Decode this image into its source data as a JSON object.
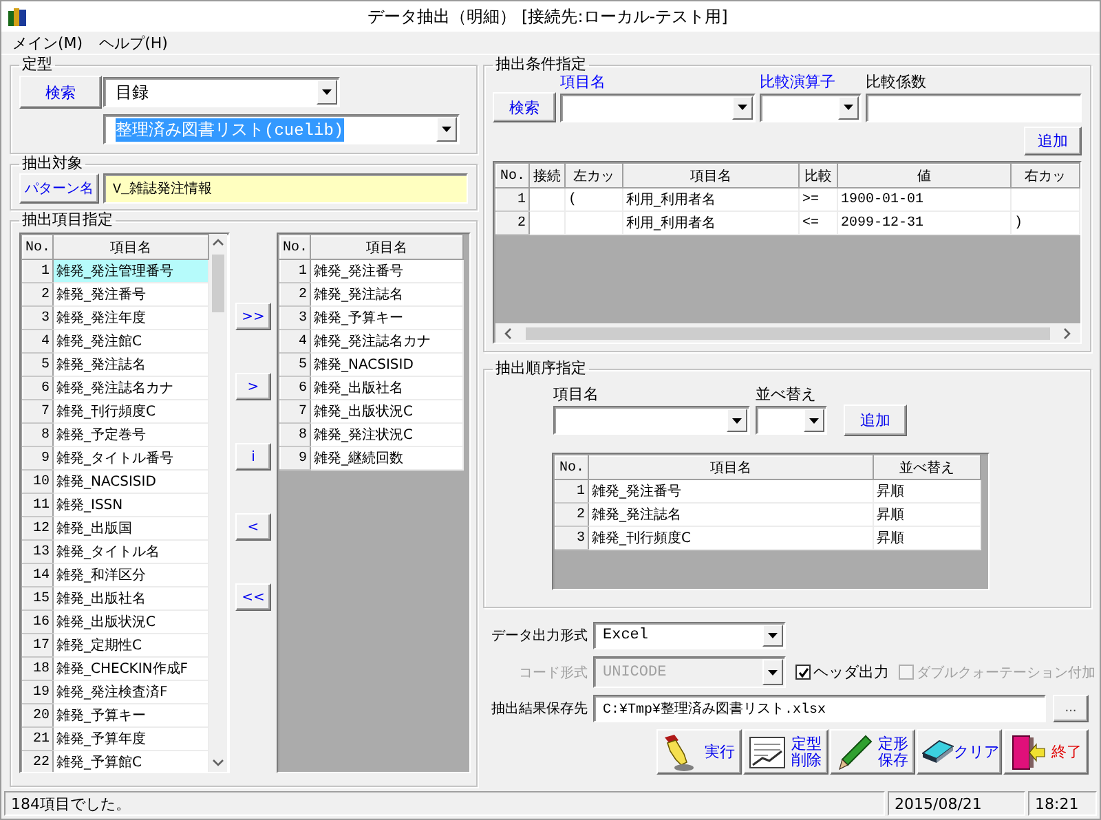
{
  "window": {
    "title": "データ抽出（明細） [接続先:ローカル-テスト用]"
  },
  "menu": [
    "メイン(M)",
    "ヘルプ(H)"
  ],
  "template_group": {
    "title": "定型",
    "search_button": "検索",
    "category": "目録",
    "template": {
      "value": "整理済み図書リスト(cuelib)",
      "text_selected": true
    }
  },
  "target_group": {
    "title": "抽出対象",
    "pattern_button": "パターン名",
    "pattern": "V_雑誌発注情報"
  },
  "items_group": {
    "title": "抽出項目指定",
    "available": {
      "columns": [
        "No.",
        "項目名"
      ],
      "rows": [
        {
          "no": "1",
          "name": "雑発_発注管理番号",
          "selected": true
        },
        {
          "no": "2",
          "name": "雑発_発注番号",
          "selected": false
        },
        {
          "no": "3",
          "name": "雑発_発注年度",
          "selected": false
        },
        {
          "no": "4",
          "name": "雑発_発注館C",
          "selected": false
        },
        {
          "no": "5",
          "name": "雑発_発注誌名",
          "selected": false
        },
        {
          "no": "6",
          "name": "雑発_発注誌名カナ",
          "selected": false
        },
        {
          "no": "7",
          "name": "雑発_刊行頻度C",
          "selected": false
        },
        {
          "no": "8",
          "name": "雑発_予定巻号",
          "selected": false
        },
        {
          "no": "9",
          "name": "雑発_タイトル番号",
          "selected": false
        },
        {
          "no": "10",
          "name": "雑発_NACSISID",
          "selected": false
        },
        {
          "no": "11",
          "name": "雑発_ISSN",
          "selected": false
        },
        {
          "no": "12",
          "name": "雑発_出版国",
          "selected": false
        },
        {
          "no": "13",
          "name": "雑発_タイトル名",
          "selected": false
        },
        {
          "no": "14",
          "name": "雑発_和洋区分",
          "selected": false
        },
        {
          "no": "15",
          "name": "雑発_出版社名",
          "selected": false
        },
        {
          "no": "16",
          "name": "雑発_出版状況C",
          "selected": false
        },
        {
          "no": "17",
          "name": "雑発_定期性C",
          "selected": false
        },
        {
          "no": "18",
          "name": "雑発_CHECKIN作成F",
          "selected": false
        },
        {
          "no": "19",
          "name": "雑発_発注検査済F",
          "selected": false
        },
        {
          "no": "20",
          "name": "雑発_予算キー",
          "selected": false
        },
        {
          "no": "21",
          "name": "雑発_予算年度",
          "selected": false
        },
        {
          "no": "22",
          "name": "雑発_予算館C",
          "selected": false
        }
      ]
    },
    "move_buttons": [
      ">>",
      ">",
      "i",
      "<",
      "<<"
    ],
    "chosen": {
      "columns": [
        "No.",
        "項目名"
      ],
      "rows": [
        {
          "no": "1",
          "name": "雑発_発注番号"
        },
        {
          "no": "2",
          "name": "雑発_発注誌名"
        },
        {
          "no": "3",
          "name": "雑発_予算キー"
        },
        {
          "no": "4",
          "name": "雑発_発注誌名カナ"
        },
        {
          "no": "5",
          "name": "雑発_NACSISID"
        },
        {
          "no": "6",
          "name": "雑発_出版社名"
        },
        {
          "no": "7",
          "name": "雑発_出版状況C"
        },
        {
          "no": "8",
          "name": "雑発_発注状況C"
        },
        {
          "no": "9",
          "name": "雑発_継続回数"
        }
      ]
    }
  },
  "condition_group": {
    "title": "抽出条件指定",
    "search_button": "検索",
    "field_labels": [
      {
        "text": "項目名",
        "color": "#0000ff"
      },
      {
        "text": "比較演算子",
        "color": "#0000ff"
      },
      {
        "text": "比較係数",
        "color": "#000000"
      }
    ],
    "add_button": "追加",
    "table": {
      "columns": [
        "No.",
        "接続",
        "左カッ",
        "項目名",
        "比較",
        "値",
        "右カッ"
      ],
      "rows": [
        {
          "no": "1",
          "left_paren": "(",
          "item": "利用_利用者名",
          "op": ">=",
          "value": "1900-01-01"
        },
        {
          "no": "2",
          "item": "利用_利用者名",
          "op": "<=",
          "value": "2099-12-31",
          "right_paren": ")"
        }
      ]
    }
  },
  "order_group": {
    "title": "抽出順序指定",
    "field_labels": [
      "項目名",
      "並べ替え"
    ],
    "add_button": "追加",
    "table": {
      "columns": [
        "No.",
        "項目名",
        "並べ替え"
      ],
      "rows": [
        {
          "no": "1",
          "item": "雑発_発注番号",
          "order": "昇順"
        },
        {
          "no": "2",
          "item": "雑発_発注誌名",
          "order": "昇順"
        },
        {
          "no": "3",
          "item": "雑発_刊行頻度C",
          "order": "昇順"
        }
      ]
    }
  },
  "output": {
    "format_label": "データ出力形式",
    "format": "Excel",
    "code": {
      "label": "コード形式",
      "value": "UNICODE",
      "disabled": true
    },
    "header_checkbox": {
      "label": "ヘッダ出力",
      "checked": true,
      "disabled": false
    },
    "quote_checkbox": {
      "label": "ダブルクォーテーション付加",
      "checked": false,
      "disabled": true
    },
    "path_label": "抽出結果保存先",
    "path": "C:¥Tmp¥整理済み図書リスト.xlsx",
    "browse_button": "..."
  },
  "actions": [
    {
      "kind": "run",
      "lines": [
        "実行"
      ]
    },
    {
      "kind": "delete",
      "lines": [
        "定型",
        "削除"
      ]
    },
    {
      "kind": "save",
      "lines": [
        "定形",
        "保存"
      ]
    },
    {
      "kind": "clear",
      "lines": [
        "クリア"
      ]
    },
    {
      "kind": "exit",
      "lines": [
        "終了"
      ]
    }
  ],
  "status_bar": {
    "message": "184項目でした。",
    "date": "2015/08/21",
    "time": "18:21"
  }
}
